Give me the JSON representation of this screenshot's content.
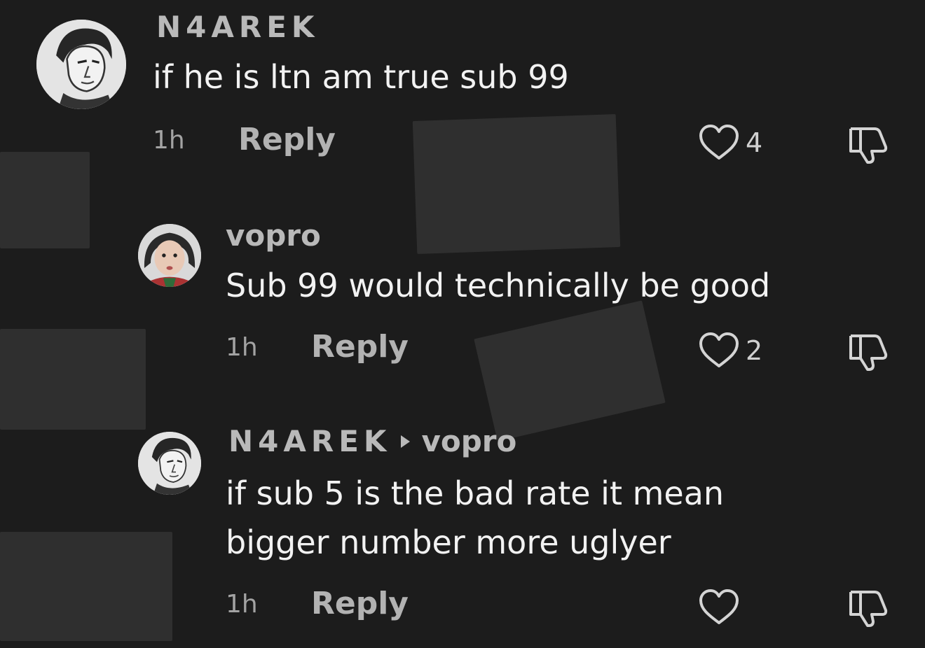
{
  "comments": [
    {
      "username": "N4AREK",
      "reply_to": "",
      "text": "if he is ltn am true sub 99",
      "time": "1h",
      "reply_label": "Reply",
      "likes": "4",
      "avatar_icon": "man-portrait-icon"
    },
    {
      "username": "vopro",
      "reply_to": "",
      "text": "Sub 99 would technically be good",
      "time": "1h",
      "reply_label": "Reply",
      "likes": "2",
      "avatar_icon": "woman-portrait-icon"
    },
    {
      "username": "N4AREK",
      "reply_to": "vopro",
      "text_line1": "if sub 5 is the bad rate it mean",
      "text_line2": "bigger number more uglyer",
      "time": "1h",
      "reply_label": "Reply",
      "likes": "",
      "avatar_icon": "man-portrait-icon"
    }
  ],
  "colors": {
    "background": "#1c1c1c",
    "text": "#f2f2f2",
    "muted": "#b9b9b9",
    "redaction": "#2f2f2f"
  }
}
